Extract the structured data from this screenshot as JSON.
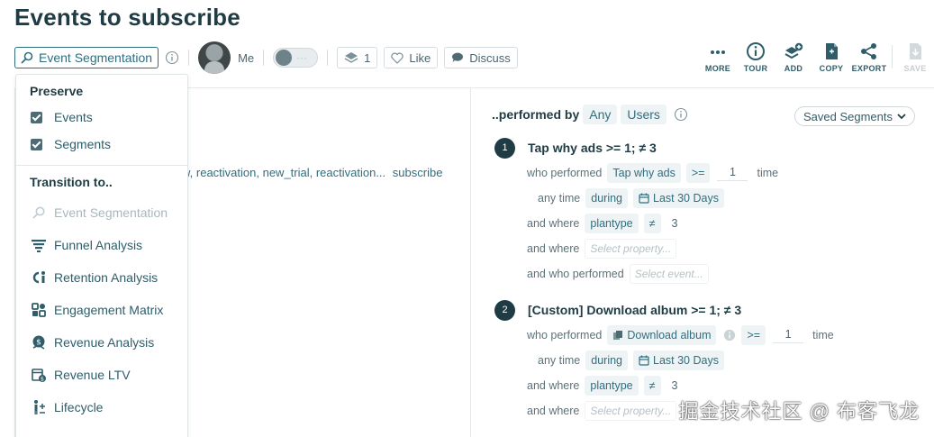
{
  "page": {
    "title": "Events to subscribe"
  },
  "toolbar": {
    "report_type": "Event Segmentation",
    "user": "Me",
    "layers_count": "1",
    "like": "Like",
    "discuss": "Discuss"
  },
  "actions": [
    {
      "label": "MORE",
      "icon": "more-icon"
    },
    {
      "label": "TOUR",
      "icon": "tour-info-icon"
    },
    {
      "label": "ADD",
      "icon": "add-stack-icon"
    },
    {
      "label": "COPY",
      "icon": "copy-icon"
    },
    {
      "label": "EXPORT",
      "icon": "share-icon"
    },
    {
      "label": "SAVE",
      "icon": "save-icon"
    }
  ],
  "dropdown": {
    "preserve_header": "Preserve",
    "preserve_items": [
      "Events",
      "Segments"
    ],
    "transition_header": "Transition to..",
    "transition_items": [
      {
        "label": "Event Segmentation",
        "icon": "segmentation-icon",
        "disabled": true
      },
      {
        "label": "Funnel Analysis",
        "icon": "funnel-icon"
      },
      {
        "label": "Retention Analysis",
        "icon": "retention-icon"
      },
      {
        "label": "Engagement Matrix",
        "icon": "matrix-icon"
      },
      {
        "label": "Revenue Analysis",
        "icon": "revenue-icon"
      },
      {
        "label": "Revenue LTV",
        "icon": "ltv-icon"
      },
      {
        "label": "Lifecycle",
        "icon": "lifecycle-icon"
      }
    ]
  },
  "left_panel": {
    "event_filter_text": "w, reactivation, new_trial, reactivation...",
    "event_filter_suffix": "subscribe"
  },
  "segment": {
    "performed_by_label": "..performed by",
    "any": "Any",
    "users": "Users",
    "saved_segments": "Saved Segments",
    "events": [
      {
        "num": "1",
        "title": "Tap why ads >= 1; ≠ 3",
        "who_performed": "who performed",
        "event_name": "Tap why ads",
        "operator": ">=",
        "count": "1",
        "unit": "time",
        "any_time": "any time",
        "during": "during",
        "range": "Last 30 Days",
        "and_where": "and where",
        "prop": "plantype",
        "prop_op": "≠",
        "prop_val": "3",
        "and_where_2": "and where",
        "select_property": "Select property...",
        "and_who_performed": "and who performed",
        "select_event": "Select event..."
      },
      {
        "num": "2",
        "title": "[Custom] Download album >= 1; ≠ 3",
        "who_performed": "who performed",
        "event_name": "Download album",
        "operator": ">=",
        "count": "1",
        "unit": "time",
        "any_time": "any time",
        "during": "during",
        "range": "Last 30 Days",
        "and_where": "and where",
        "prop": "plantype",
        "prop_op": "≠",
        "prop_val": "3",
        "and_where_2": "and where",
        "select_property": "Select property..."
      }
    ]
  },
  "watermark": "掘金技术社区 @ 布客飞龙",
  "colors": {
    "accent": "#2f6f80",
    "dark": "#1f3b44",
    "chip_bg": "#eef4f5"
  }
}
